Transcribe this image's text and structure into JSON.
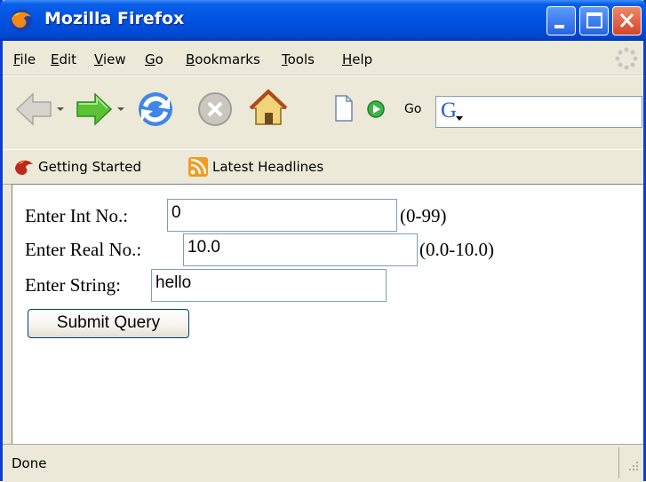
{
  "window": {
    "title": "Mozilla Firefox"
  },
  "menu": [
    {
      "label": "File",
      "key": "F",
      "rest": "ile"
    },
    {
      "label": "Edit",
      "key": "E",
      "rest": "dit"
    },
    {
      "label": "View",
      "key": "V",
      "rest": "iew"
    },
    {
      "label": "Go",
      "key": "G",
      "rest": "o"
    },
    {
      "label": "Bookmarks",
      "key": "B",
      "rest": "ookmarks"
    },
    {
      "label": "Tools",
      "key": "T",
      "rest": "ools"
    },
    {
      "label": "Help",
      "key": "H",
      "rest": "elp"
    }
  ],
  "toolbar": {
    "go_label": "Go",
    "search_engine": "G"
  },
  "bookmarks": [
    {
      "label": "Getting Started",
      "icon": "firefox-icon"
    },
    {
      "label": "Latest Headlines",
      "icon": "rss-feed-icon"
    }
  ],
  "form": {
    "int_label": "Enter Int No.:",
    "int_value": "0",
    "int_range": "(0-99)",
    "real_label": "Enter Real No.:",
    "real_value": "10.0",
    "real_range": "(0.0-10.0)",
    "string_label": "Enter String:",
    "string_value": "hello",
    "submit_label": "Submit Query"
  },
  "status": {
    "text": "Done"
  },
  "colors": {
    "titlebar": "#0052e0",
    "close_button": "#d4452a",
    "chrome": "#ece9d8"
  }
}
